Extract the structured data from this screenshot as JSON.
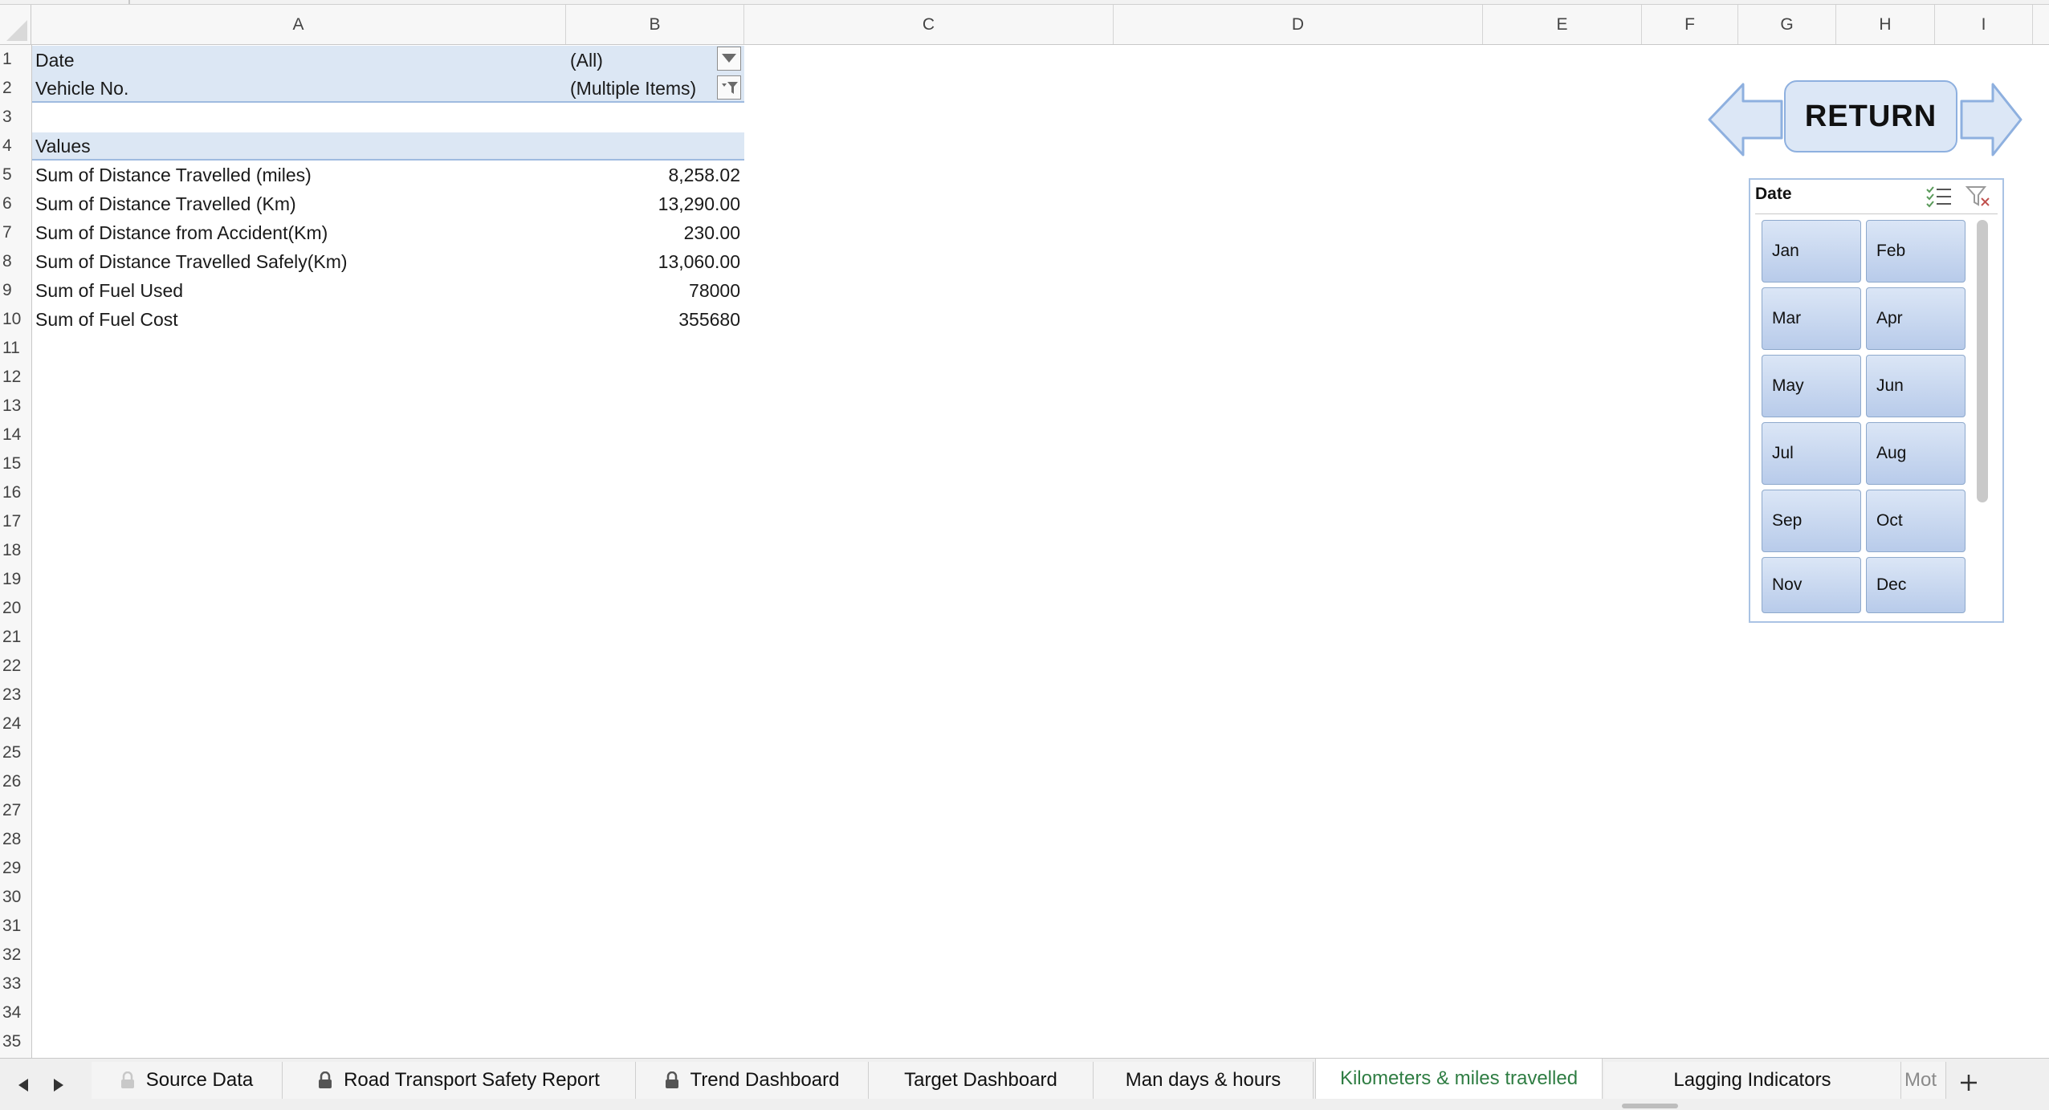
{
  "columns": [
    "A",
    "B",
    "C",
    "D",
    "E",
    "F",
    "G",
    "H",
    "I"
  ],
  "rows": [
    "1",
    "2",
    "3",
    "4",
    "5",
    "6",
    "7",
    "8",
    "9",
    "10",
    "11",
    "12",
    "13",
    "14",
    "15",
    "16",
    "17",
    "18",
    "19",
    "20",
    "21",
    "22",
    "23",
    "24",
    "25",
    "26",
    "27",
    "28",
    "29",
    "30",
    "31",
    "32",
    "33",
    "34",
    "35"
  ],
  "pivot": {
    "filters": [
      {
        "label": "Date",
        "value": "(All)"
      },
      {
        "label": "Vehicle No.",
        "value": "(Multiple Items)"
      }
    ],
    "values_header": "Values",
    "values": [
      {
        "label": "Sum of Distance Travelled (miles)",
        "value": "8,258.02"
      },
      {
        "label": "Sum of Distance Travelled (Km)",
        "value": "13,290.00"
      },
      {
        "label": "Sum of Distance from Accident(Km)",
        "value": "230.00"
      },
      {
        "label": "Sum of Distance Travelled Safely(Km)",
        "value": "13,060.00"
      },
      {
        "label": "Sum of Fuel Used",
        "value": "78000"
      },
      {
        "label": "Sum of Fuel Cost",
        "value": "355680"
      }
    ]
  },
  "return_button": {
    "label": "RETURN"
  },
  "slicer": {
    "title": "Date",
    "items": [
      "Jan",
      "Feb",
      "Mar",
      "Apr",
      "May",
      "Jun",
      "Jul",
      "Aug",
      "Sep",
      "Oct",
      "Nov",
      "Dec"
    ]
  },
  "sheet_tabs": [
    {
      "label": "Source Data",
      "locked": true
    },
    {
      "label": "Road Transport Safety Report",
      "locked": true
    },
    {
      "label": "Trend Dashboard",
      "locked": true
    },
    {
      "label": "Target Dashboard",
      "locked": false
    },
    {
      "label": "Man days & hours",
      "locked": false
    },
    {
      "label": "Kilometers & miles travelled",
      "locked": false,
      "active": true
    },
    {
      "label": "Lagging Indicators",
      "locked": false
    },
    {
      "label": "Mot",
      "locked": false
    }
  ],
  "colors": {
    "accent_tab": "#2f7d43",
    "pivot_band": "#dce7f4",
    "slicer_button": "#c9d8f0"
  }
}
